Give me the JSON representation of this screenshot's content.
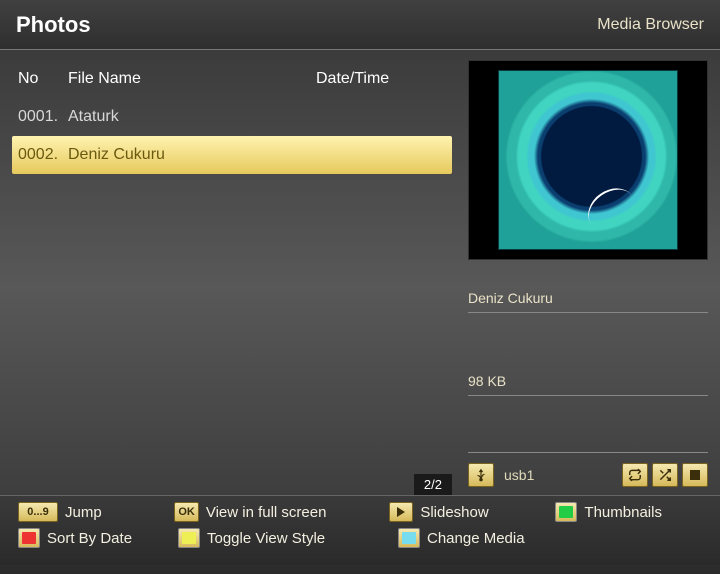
{
  "header": {
    "title": "Photos",
    "app": "Media Browser"
  },
  "columns": {
    "no": "No",
    "filename": "File Name",
    "datetime": "Date/Time"
  },
  "files": [
    {
      "no": "0001.",
      "name": "Ataturk",
      "date": "",
      "selected": false
    },
    {
      "no": "0002.",
      "name": "Deniz Cukuru",
      "date": "",
      "selected": true
    }
  ],
  "page": "2/2",
  "preview": {
    "name": "Deniz Cukuru",
    "size": "98 KB",
    "source": "usb1"
  },
  "icons": {
    "usb": "usb-icon",
    "repeat": "repeat-icon",
    "shuffle": "shuffle-icon",
    "stop": "stop-icon"
  },
  "footer": {
    "jump": {
      "key": "0...9",
      "label": "Jump"
    },
    "ok": {
      "key": "OK",
      "label": "View in full screen"
    },
    "slideshow": {
      "label": "Slideshow"
    },
    "thumbnails": {
      "label": "Thumbnails"
    },
    "sort": {
      "label": "Sort By Date"
    },
    "toggle": {
      "label": "Toggle View Style"
    },
    "changemedia": {
      "label": "Change Media"
    }
  }
}
